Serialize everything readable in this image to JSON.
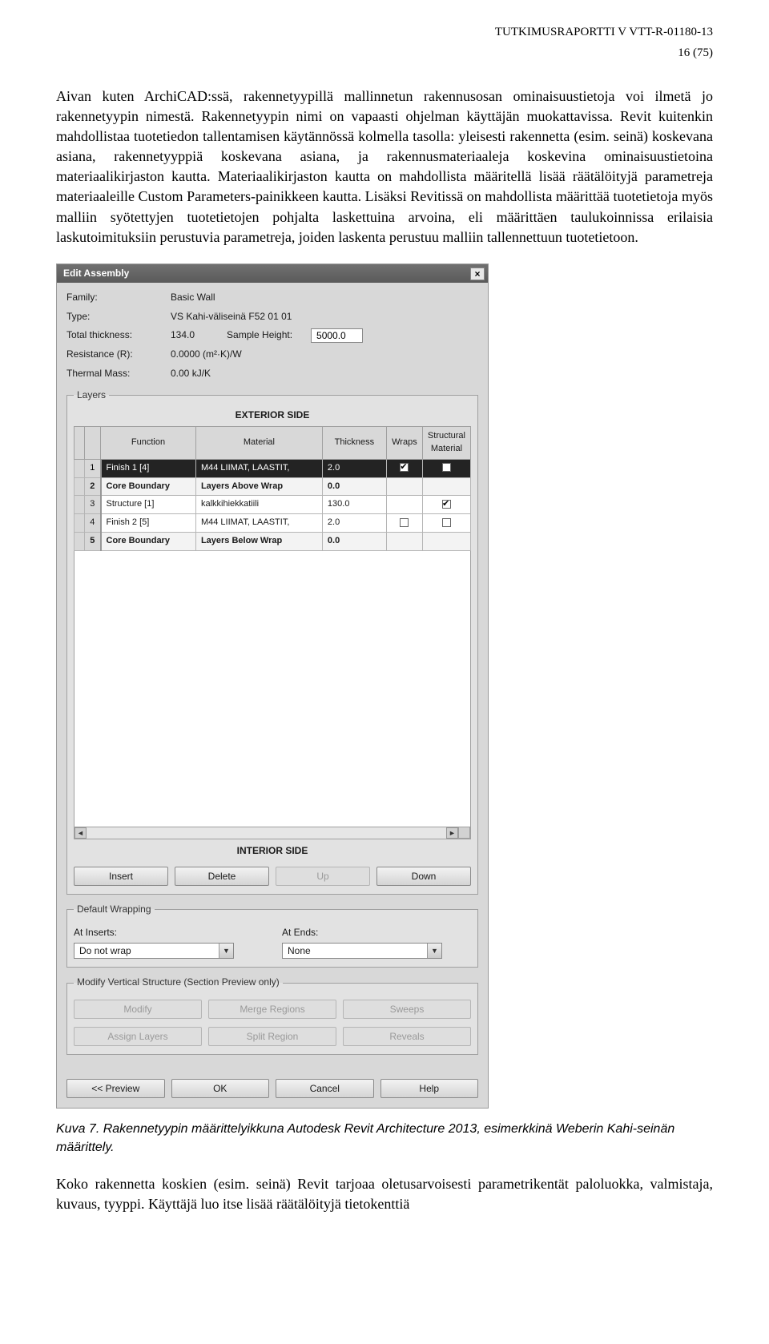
{
  "header": {
    "report_line": "TUTKIMUSRAPORTTI V VTT-R-01180-13",
    "page_num": "16 (75)"
  },
  "paragraph1": "Aivan kuten ArchiCAD:ssä, rakennetyypillä mallinnetun rakennusosan ominaisuustietoja voi ilmetä jo rakennetyypin nimestä. Rakennetyypin nimi on vapaasti ohjelman käyttäjän muokattavissa. Revit kuitenkin mahdollistaa tuotetiedon tallentamisen käytännössä kolmella tasolla: yleisesti rakennetta (esim. seinä) koskevana asiana, rakennetyyppiä koskevana asiana, ja rakennusmateriaaleja koskevina ominaisuustietoina materiaalikirjaston kautta. Materiaalikirjaston kautta on mahdollista määritellä lisää räätälöityjä parametreja materiaaleille Custom Parameters-painikkeen kautta. Lisäksi Revitissä on mahdollista määrittää tuotetietoja myös malliin syötettyjen tuotetietojen pohjalta laskettuina arvoina, eli määrittäen taulukoinnissa erilaisia laskutoimituksiin perustuvia parametreja, joiden laskenta perustuu malliin tallennettuun tuotetietoon.",
  "dialog": {
    "title": "Edit Assembly",
    "info": {
      "family_label": "Family:",
      "family_value": "Basic Wall",
      "type_label": "Type:",
      "type_value": "VS Kahi-väliseinä F52 01 01",
      "total_label": "Total thickness:",
      "total_value": "134.0",
      "sample_label": "Sample Height:",
      "sample_value": "5000.0",
      "resist_label": "Resistance (R):",
      "resist_value": "0.0000 (m²·K)/W",
      "thermal_label": "Thermal Mass:",
      "thermal_value": "0.00 kJ/K"
    },
    "layers_legend": "Layers",
    "exterior": "EXTERIOR SIDE",
    "interior": "INTERIOR SIDE",
    "headers": [
      "",
      "",
      "Function",
      "Material",
      "Thickness",
      "Wraps",
      "Structural Material"
    ],
    "rows": [
      {
        "n": "1",
        "func": "Finish 1 [4]",
        "mat": "M44 LIIMAT, LAASTIT,",
        "th": "2.0",
        "wrap": "on",
        "struct": "off",
        "sel": true
      },
      {
        "n": "2",
        "func": "Core Boundary",
        "mat": "Layers Above Wrap",
        "th": "0.0",
        "bold": true
      },
      {
        "n": "3",
        "func": "Structure [1]",
        "mat": "kalkkihiekkatiili",
        "th": "130.0",
        "wrap": "",
        "struct": "on"
      },
      {
        "n": "4",
        "func": "Finish 2 [5]",
        "mat": "M44 LIIMAT, LAASTIT,",
        "th": "2.0",
        "wrap": "off",
        "struct": "off"
      },
      {
        "n": "5",
        "func": "Core Boundary",
        "mat": "Layers Below Wrap",
        "th": "0.0",
        "bold": true
      }
    ],
    "scroll_left": "◄",
    "scroll_right": "►",
    "row_btns": {
      "insert": "Insert",
      "delete": "Delete",
      "up": "Up",
      "down": "Down"
    },
    "wrapping": {
      "legend": "Default Wrapping",
      "at_inserts_label": "At Inserts:",
      "at_inserts_val": "Do not wrap",
      "at_ends_label": "At Ends:",
      "at_ends_val": "None"
    },
    "vertical": {
      "legend": "Modify Vertical Structure (Section Preview only)",
      "modify": "Modify",
      "merge": "Merge Regions",
      "sweeps": "Sweeps",
      "assign": "Assign Layers",
      "split": "Split Region",
      "reveals": "Reveals"
    },
    "footer": {
      "preview": "<< Preview",
      "ok": "OK",
      "cancel": "Cancel",
      "help": "Help"
    }
  },
  "caption": {
    "prefix": "Kuva 7. ",
    "text": "Rakennetyypin määrittelyikkuna Autodesk Revit Architecture 2013, esimerkkinä Weberin Kahi-seinän määrittely."
  },
  "paragraph2": "Koko rakennetta koskien (esim. seinä) Revit tarjoaa oletusarvoisesti parametrikentät paloluokka, valmistaja, kuvaus, tyyppi. Käyttäjä luo itse lisää räätälöityjä tietokenttiä"
}
